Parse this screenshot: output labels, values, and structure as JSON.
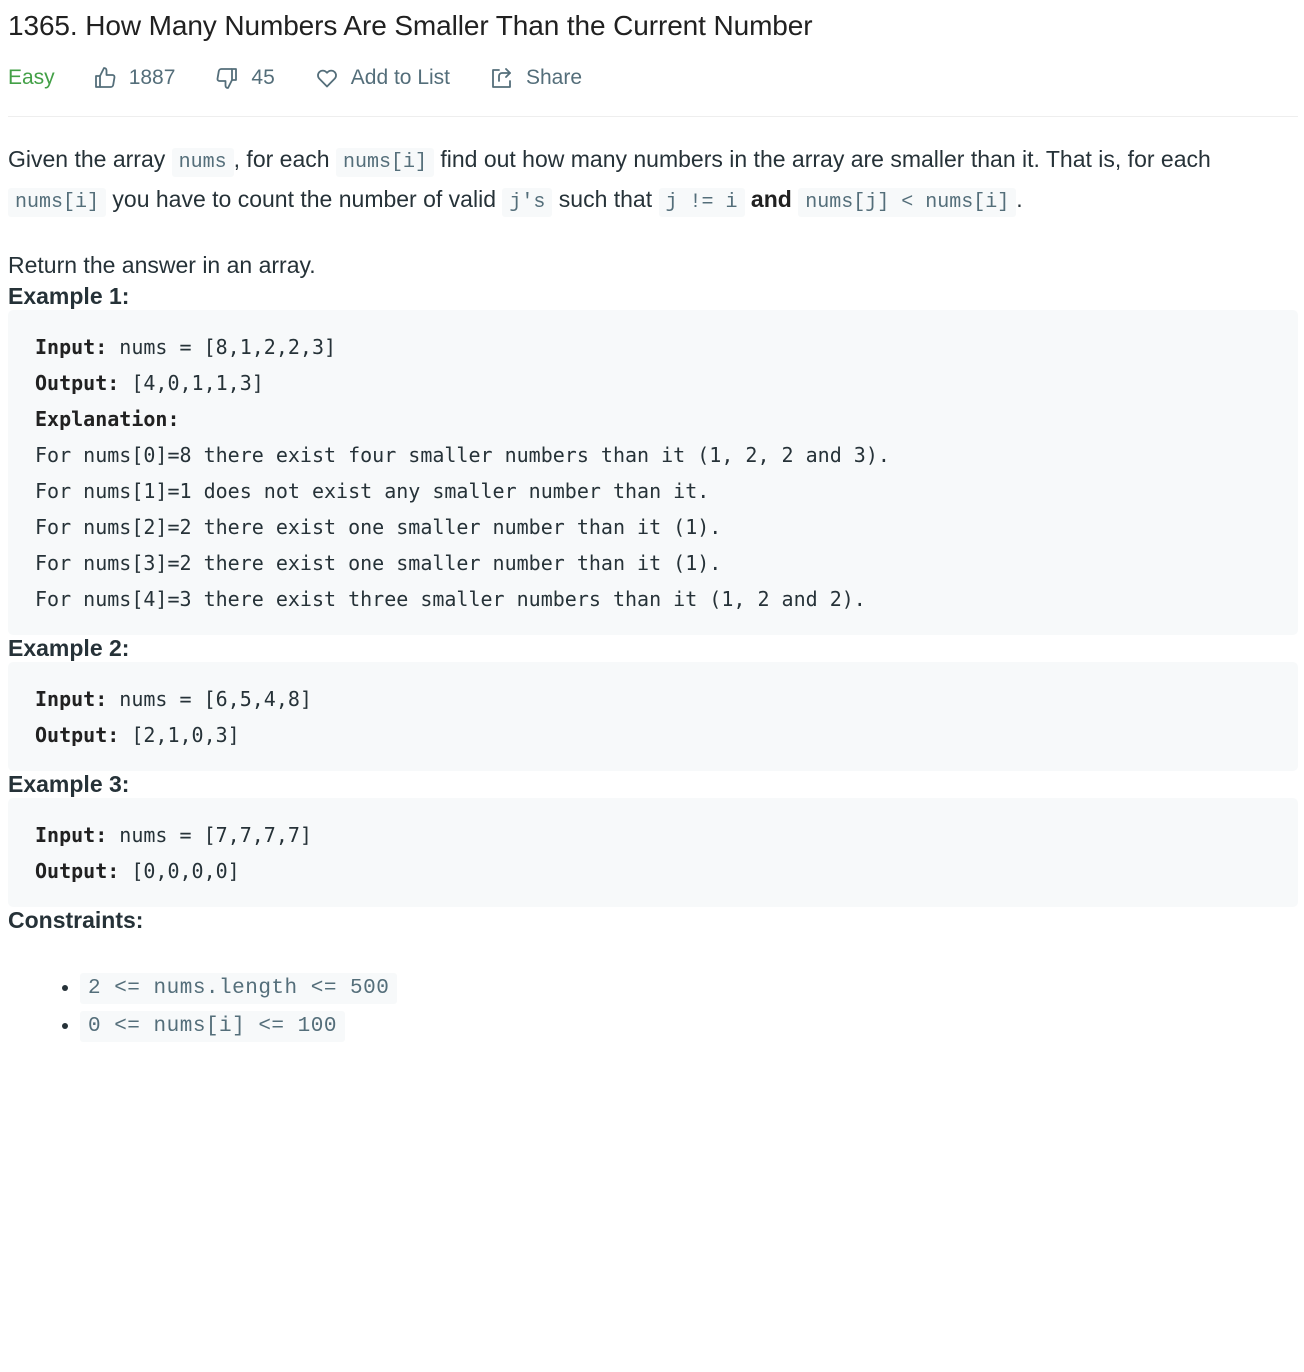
{
  "problem": {
    "title": "1365. How Many Numbers Are Smaller Than the Current Number",
    "difficulty": "Easy",
    "likes": "1887",
    "dislikes": "45",
    "add_to_list_label": "Add to List",
    "share_label": "Share"
  },
  "colors": {
    "difficulty_easy": "#43a047",
    "meta_text": "#546e7a",
    "code_bg": "#f7f9fa"
  },
  "description": {
    "p1": {
      "t1": "Given the array ",
      "c1": "nums",
      "t2": ", for each ",
      "c2": "nums[i]",
      "t3": " find out how many numbers in the array are smaller than it. That is, for each ",
      "c3": "nums[i]",
      "t4": " you have to count the number of valid ",
      "c4": "j's",
      "t5": " such that ",
      "c5": "j != i",
      "b1": "and",
      "c6": "nums[j] < nums[i]",
      "t6": "."
    },
    "p2": "Return the answer in an array."
  },
  "examples": [
    {
      "heading": "Example 1:",
      "input_label": "Input:",
      "input_value": " nums = [8,1,2,2,3]",
      "output_label": "Output:",
      "output_value": " [4,0,1,1,3]",
      "explanation_label": "Explanation:",
      "explanation_lines": [
        "For nums[0]=8 there exist four smaller numbers than it (1, 2, 2 and 3).",
        "For nums[1]=1 does not exist any smaller number than it.",
        "For nums[2]=2 there exist one smaller number than it (1).",
        "For nums[3]=2 there exist one smaller number than it (1).",
        "For nums[4]=3 there exist three smaller numbers than it (1, 2 and 2)."
      ]
    },
    {
      "heading": "Example 2:",
      "input_label": "Input:",
      "input_value": " nums = [6,5,4,8]",
      "output_label": "Output:",
      "output_value": " [2,1,0,3]"
    },
    {
      "heading": "Example 3:",
      "input_label": "Input:",
      "input_value": " nums = [7,7,7,7]",
      "output_label": "Output:",
      "output_value": " [0,0,0,0]"
    }
  ],
  "constraints": {
    "heading": "Constraints:",
    "items": [
      "2 <= nums.length <= 500",
      "0 <= nums[i] <= 100"
    ]
  }
}
